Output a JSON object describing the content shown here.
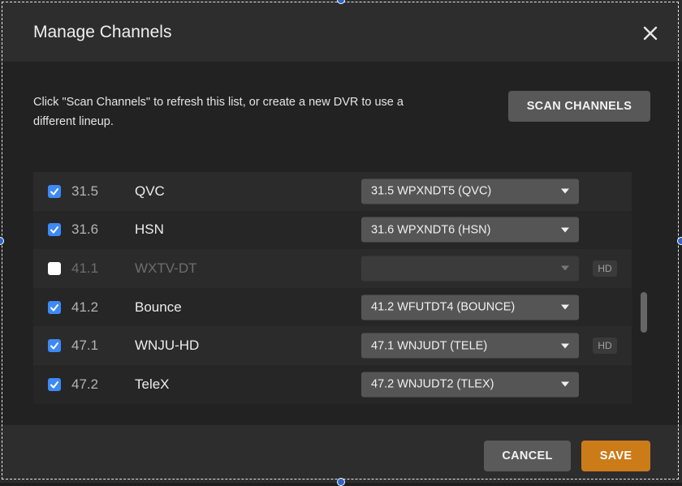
{
  "dialog": {
    "title": "Manage Channels",
    "close_icon": "close-icon",
    "description": "Click \"Scan Channels\" to refresh this list, or create a new DVR to use a different lineup.",
    "scan_button": "SCAN CHANNELS"
  },
  "channels": [
    {
      "checked": true,
      "number": "31.5",
      "name": "QVC",
      "selection": "31.5 WPXNDT5 (QVC)",
      "hd": false,
      "disabled": false
    },
    {
      "checked": true,
      "number": "31.6",
      "name": "HSN",
      "selection": "31.6 WPXNDT6 (HSN)",
      "hd": false,
      "disabled": false
    },
    {
      "checked": false,
      "number": "41.1",
      "name": "WXTV-DT",
      "selection": "",
      "hd": true,
      "disabled": true
    },
    {
      "checked": true,
      "number": "41.2",
      "name": "Bounce",
      "selection": "41.2 WFUTDT4 (BOUNCE)",
      "hd": false,
      "disabled": false
    },
    {
      "checked": true,
      "number": "47.1",
      "name": "WNJU-HD",
      "selection": "47.1 WNJUDT (TELE)",
      "hd": true,
      "disabled": false
    },
    {
      "checked": true,
      "number": "47.2",
      "name": "TeleX",
      "selection": "47.2 WNJUDT2 (TLEX)",
      "hd": false,
      "disabled": false
    }
  ],
  "badge_label": "HD",
  "footer": {
    "cancel_label": "CANCEL",
    "save_label": "SAVE"
  },
  "colors": {
    "accent": "#cc7b19",
    "checkbox": "#3d8af7",
    "selection_handle": "#2f66c8"
  }
}
